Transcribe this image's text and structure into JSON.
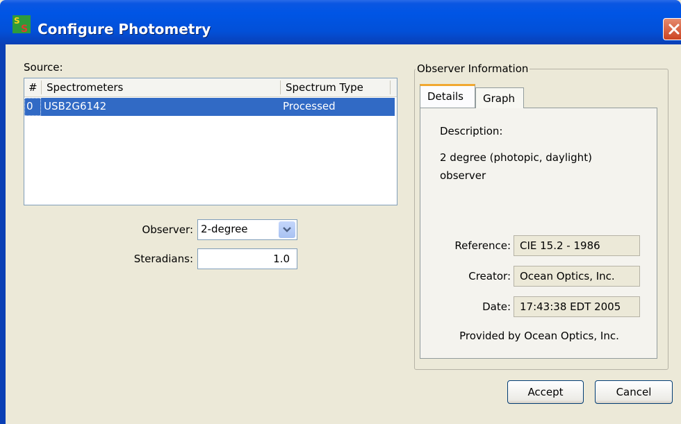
{
  "window": {
    "title": "Configure Photometry"
  },
  "source": {
    "label": "Source:",
    "columns": {
      "index": "#",
      "spectrometers": "Spectrometers",
      "spectrum_type": "Spectrum Type"
    },
    "rows": [
      {
        "index": "0",
        "spectrometer": "USB2G6142",
        "spectrum_type": "Processed"
      }
    ]
  },
  "observer": {
    "label": "Observer:",
    "value": "2-degree"
  },
  "steradians": {
    "label": "Steradians:",
    "value": "1.0"
  },
  "observer_info": {
    "group_title": "Observer Information",
    "tabs": [
      {
        "label": "Details",
        "selected": true
      },
      {
        "label": "Graph",
        "selected": false
      }
    ],
    "description_label": "Description:",
    "description_line1": "2 degree (photopic, daylight)",
    "description_line2": "observer",
    "reference_label": "Reference:",
    "reference_value": "CIE 15.2 - 1986",
    "creator_label": "Creator:",
    "creator_value": "Ocean Optics, Inc.",
    "date_label": "Date:",
    "date_value": "17:43:38 EDT 2005",
    "provided_by": "Provided by Ocean Optics, Inc."
  },
  "buttons": {
    "accept": "Accept",
    "cancel": "Cancel"
  },
  "colors": {
    "titlebar": "#0055e5",
    "selection": "#316ac5",
    "window_bg": "#ece9d8",
    "tab_accent": "#f1a831"
  }
}
